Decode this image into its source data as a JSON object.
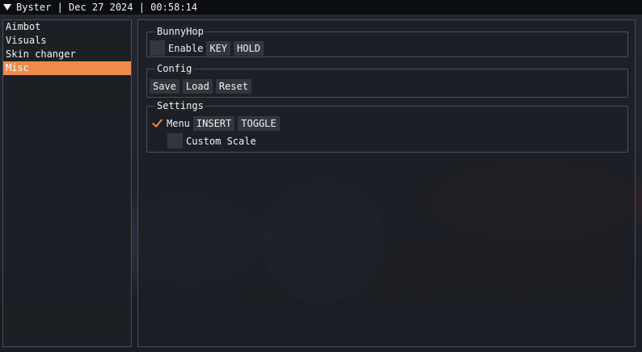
{
  "title": "Byster | Dec 27 2024 | 00:58:14",
  "sidebar": {
    "items": [
      {
        "label": "Aimbot"
      },
      {
        "label": "Visuals"
      },
      {
        "label": "Skin changer"
      },
      {
        "label": "Misc",
        "active": true
      }
    ]
  },
  "bunnyhop": {
    "title": "BunnyHop",
    "enable": {
      "label": "Enable",
      "checked": false
    },
    "key_label": "KEY",
    "mode_label": "HOLD"
  },
  "config": {
    "title": "Config",
    "save_label": "Save",
    "load_label": "Load",
    "reset_label": "Reset"
  },
  "settings": {
    "title": "Settings",
    "menu": {
      "label": "Menu",
      "checked": true
    },
    "menu_key_label": "INSERT",
    "menu_mode_label": "TOGGLE",
    "custom_scale": {
      "label": "Custom Scale",
      "checked": false
    }
  },
  "colors": {
    "accent": "#f08a4b",
    "panel_border": "#4a4e56",
    "control_bg": "#33363c"
  }
}
